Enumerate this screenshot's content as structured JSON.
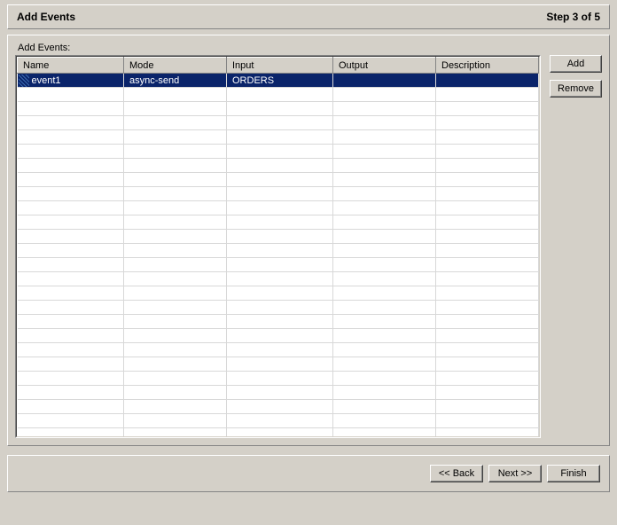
{
  "header": {
    "title": "Add Events",
    "step": "Step 3 of 5"
  },
  "label": "Add Events:",
  "table": {
    "columns": [
      "Name",
      "Mode",
      "Input",
      "Output",
      "Description"
    ],
    "rows": [
      {
        "name": "event1",
        "mode": "async-send",
        "input": "ORDERS",
        "output": "",
        "description": "",
        "selected": true
      }
    ],
    "empty_row_count": 25
  },
  "buttons": {
    "add": "Add",
    "remove": "Remove",
    "back": "<< Back",
    "next": "Next >>",
    "finish": "Finish"
  }
}
